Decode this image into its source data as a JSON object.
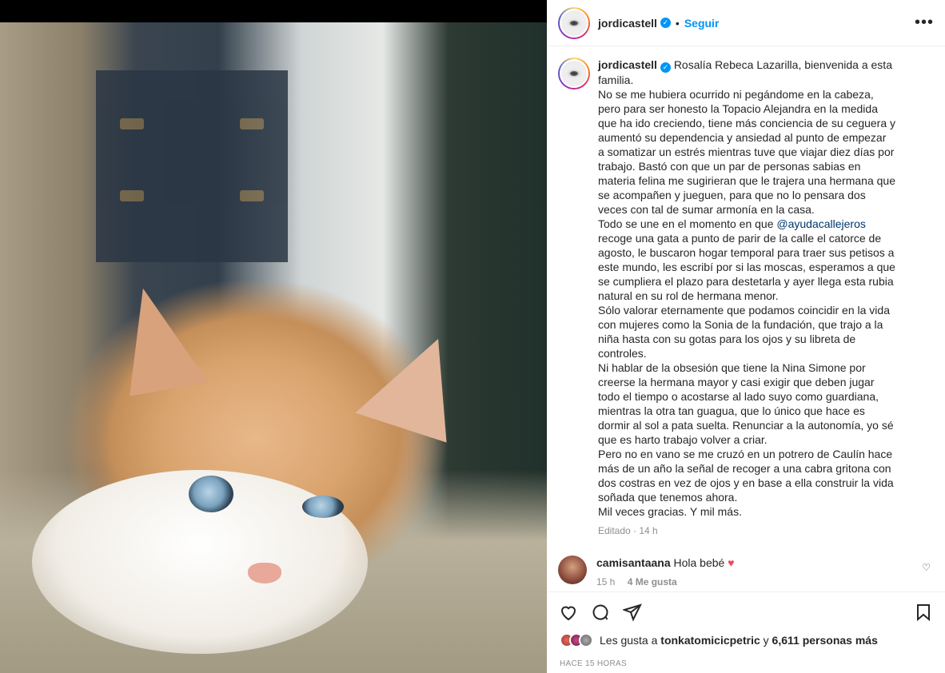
{
  "post": {
    "username": "jordicastell",
    "verified_mark": "✓",
    "separator": "•",
    "follow_label": "Seguir",
    "more_icon": "•••"
  },
  "caption": {
    "username": "jordicastell",
    "text": "Rosalía Rebeca Lazarilla, bienvenida a esta familia.\nNo se me hubiera ocurrido ni pegándome en la cabeza, pero para ser honesto la Topacio Alejandra en la medida que ha ido creciendo, tiene más conciencia de su ceguera y aumentó su dependencia y ansiedad al punto de empezar a somatizar un estrés mientras tuve que viajar diez días por trabajo. Bastó con que un par de personas sabias en materia felina me sugirieran que le trajera una hermana que se acompañen y jueguen, para que no lo pensara dos veces con tal de sumar armonía en la casa.\nTodo se une en el momento en que ",
    "mention": "@ayudacallejeros",
    "text_after": " recoge una gata a punto de parir de la calle el catorce de agosto, le buscaron hogar temporal para traer sus petisos a este mundo, les escribí por si las moscas, esperamos a que se cumpliera el plazo para destetarla y ayer llega esta rubia natural en su rol de hermana menor.\nSólo valorar eternamente que podamos coincidir en la vida con mujeres como la Sonia de la fundación, que trajo a la niña hasta con su gotas para los ojos y su libreta de controles.\nNi hablar de la obsesión que tiene la Nina Simone por creerse la hermana mayor y casi exigir que deben jugar todo el tiempo o acostarse al lado suyo como guardiana, mientras la otra tan guagua, que lo único que hace es dormir al sol a pata suelta. Renunciar a la autonomía, yo sé que es harto trabajo volver a criar.\nPero no en vano se me cruzó en un potrero de Caulín hace más de un año la señal de recoger a una cabra gritona con dos costras en vez de ojos y en base a ella construir la vida soñada que tenemos ahora.\nMil veces gracias. Y mil más.",
    "edited": "Editado · 14 h"
  },
  "comments": [
    {
      "username": "camisantaana",
      "text": "Hola bebé",
      "emoji": "♥",
      "time": "15 h",
      "likes": "4 Me gusta",
      "like_icon": "♡"
    }
  ],
  "likes": {
    "prefix": "Les gusta a",
    "user": "tonkatomicicpetric",
    "middle": "y",
    "count": "6,611 personas más"
  },
  "timestamp": "HACE 15 HORAS",
  "colors": {
    "accent": "#0095f6",
    "heart": "#ed4956",
    "text": "#262626",
    "muted": "#8e8e8e"
  }
}
